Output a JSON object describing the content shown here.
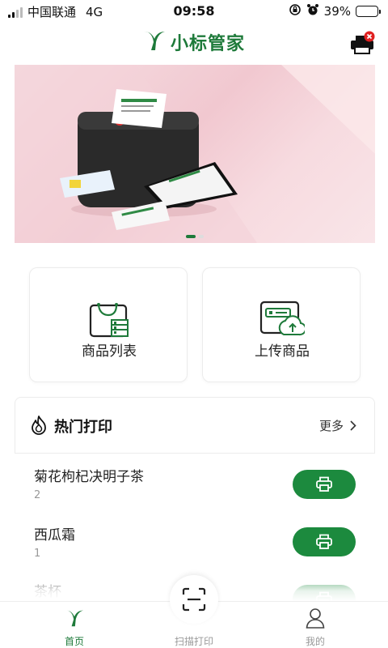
{
  "status_bar": {
    "carrier": "中国联通",
    "network": "4G",
    "time": "09:58",
    "battery": "39%",
    "battery_level": 0.39
  },
  "header": {
    "title": "小标管家",
    "printer_status": "disconnected"
  },
  "banner": {
    "slide_count": 2,
    "active_slide": 1
  },
  "actions": [
    {
      "label": "商品列表",
      "icon": "product-list-icon"
    },
    {
      "label": "上传商品",
      "icon": "upload-product-icon"
    }
  ],
  "hot_print": {
    "title": "热门打印",
    "more_label": "更多",
    "items": [
      {
        "name": "菊花枸杞决明子茶",
        "count": "2"
      },
      {
        "name": "西瓜霜",
        "count": "1"
      },
      {
        "name": "茶杯",
        "count": ""
      }
    ]
  },
  "tab_bar": {
    "tabs": [
      {
        "label": "首页",
        "icon": "home-logo-icon",
        "active": true
      },
      {
        "label": "扫描打印",
        "icon": "scan-icon",
        "active": false
      },
      {
        "label": "我的",
        "icon": "user-icon",
        "active": false
      }
    ]
  },
  "colors": {
    "brand_green": "#1e7a3a",
    "button_green": "#1c8a3e",
    "alert_red": "#e02020"
  }
}
